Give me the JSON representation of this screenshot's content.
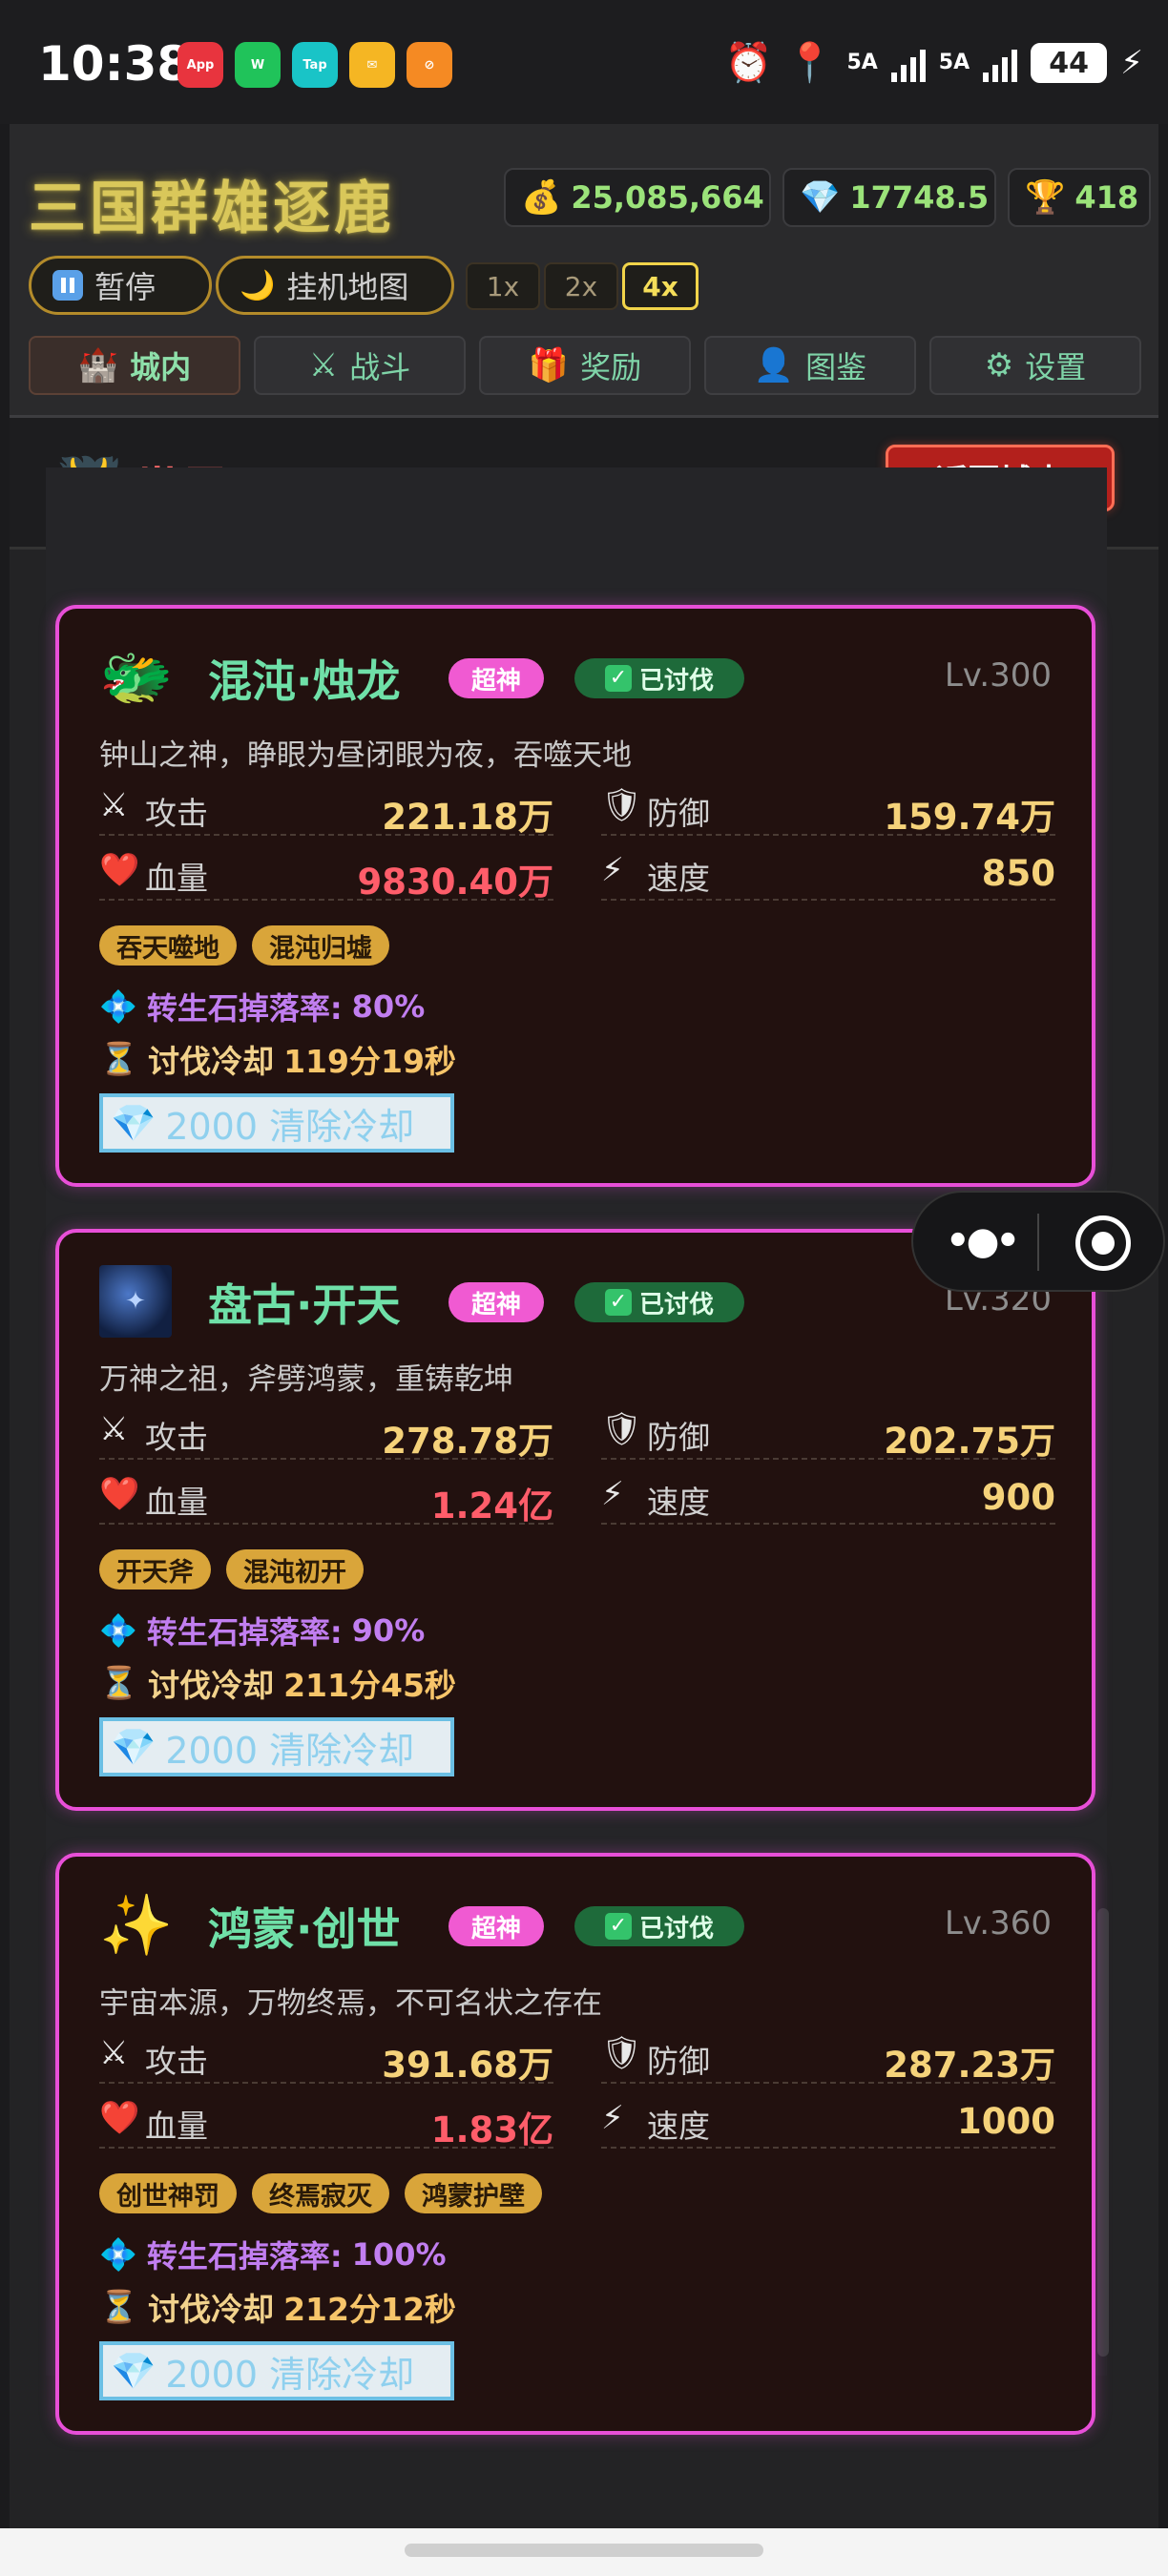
{
  "status_bar": {
    "time": "10:38",
    "apps": [
      {
        "name": "AppGallery",
        "label": "App",
        "color": "#e8343e"
      },
      {
        "name": "WeChat",
        "label": "W",
        "color": "#20c35a"
      },
      {
        "name": "TapTap",
        "label": "Tap",
        "color": "#19c4c7"
      },
      {
        "name": "Mail",
        "label": "✉",
        "color": "#f5b623"
      },
      {
        "name": "App",
        "label": "⊘",
        "color": "#f58a23"
      }
    ],
    "net1": "5A",
    "net2": "5A",
    "battery": "44"
  },
  "header": {
    "title": "三国群雄逐鹿",
    "gold": "25,085,664",
    "diamond": "17748.5",
    "trophy": "418",
    "pause_label": "暂停",
    "idle_map_label": "挂机地图",
    "speeds": [
      "1x",
      "2x",
      "4x"
    ],
    "active_speed": "4x",
    "tabs": [
      {
        "icon": "🏰",
        "label": "城内",
        "active": true
      },
      {
        "icon": "⚔",
        "label": "战斗",
        "active": false
      },
      {
        "icon": "🎁",
        "label": "奖励",
        "active": false
      },
      {
        "icon": "👤",
        "label": "图鉴",
        "active": false
      },
      {
        "icon": "⚙",
        "label": "设置",
        "active": false
      }
    ]
  },
  "boss_page": {
    "title": "世界BOSS",
    "back_label": "返回城内",
    "labels": {
      "attack": "攻击",
      "defense": "防御",
      "hp": "血量",
      "speed": "速度",
      "drop": "转生石掉落率:",
      "cooldown": "讨伐冷却",
      "clear_cooldown": "2000 清除冷却"
    },
    "bosses": [
      {
        "name": "混沌·烛龙",
        "portrait": "🐲",
        "tier": "超神",
        "status": "已讨伐",
        "level": "Lv.300",
        "desc": "钟山之神，睁眼为昼闭眼为夜，吞噬天地",
        "attack": "221.18万",
        "defense": "159.74万",
        "hp": "9830.40万",
        "speed": "850",
        "skills": [
          "吞天噬地",
          "混沌归墟"
        ],
        "drop_rate": "80%",
        "cooldown": "119分19秒"
      },
      {
        "name": "盘古·开天",
        "portrait": "✦",
        "tier": "超神",
        "status": "已讨伐",
        "level": "Lv.320",
        "desc": "万神之祖，斧劈鸿蒙，重铸乾坤",
        "attack": "278.78万",
        "defense": "202.75万",
        "hp": "1.24亿",
        "speed": "900",
        "skills": [
          "开天斧",
          "混沌初开"
        ],
        "drop_rate": "90%",
        "cooldown": "211分45秒"
      },
      {
        "name": "鸿蒙·创世",
        "portrait": "✨",
        "tier": "超神",
        "status": "已讨伐",
        "level": "Lv.360",
        "desc": "宇宙本源，万物终焉，不可名状之存在",
        "attack": "391.68万",
        "defense": "287.23万",
        "hp": "1.83亿",
        "speed": "1000",
        "skills": [
          "创世神罚",
          "终焉寂灭",
          "鸿蒙护壁"
        ],
        "drop_rate": "100%",
        "cooldown": "212分12秒"
      }
    ]
  }
}
